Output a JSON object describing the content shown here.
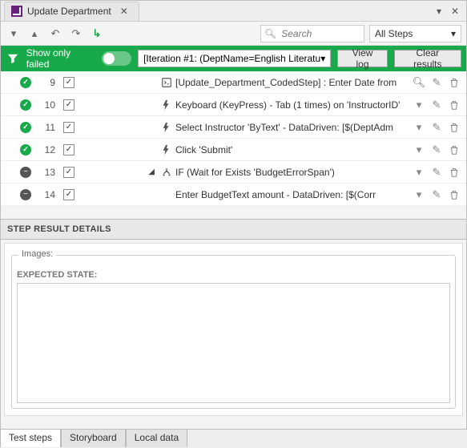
{
  "title": "Update Department",
  "toolbar": {
    "search_placeholder": "Search",
    "filter_label": "All Steps"
  },
  "greenbar": {
    "label": "Show only failed",
    "iteration": "[Iteration #1: (DeptName=English Literatu",
    "viewlog": "View log",
    "clear": "Clear results"
  },
  "steps": [
    {
      "num": "9",
      "status": "pass",
      "icon": "code",
      "desc": "[Update_Department_CodedStep] : Enter Date from",
      "extra": "search"
    },
    {
      "num": "10",
      "status": "pass",
      "icon": "bolt",
      "desc": "Keyboard (KeyPress) - Tab (1 times) on 'InstructorID'",
      "extra": "chev"
    },
    {
      "num": "11",
      "status": "pass",
      "icon": "bolt",
      "desc": "Select Instructor 'ByText'  - DataDriven: [$(DeptAdm",
      "extra": "chev"
    },
    {
      "num": "12",
      "status": "pass",
      "icon": "bolt",
      "desc": "Click 'Submit'",
      "extra": "chev"
    },
    {
      "num": "13",
      "status": "none",
      "icon": "branch",
      "desc": "IF (Wait for Exists 'BudgetErrorSpan')",
      "extra": "chev",
      "expanded": true
    },
    {
      "num": "14",
      "status": "none",
      "icon": "bolt",
      "desc": "Enter BudgetText amount - DataDriven: [$(Corr",
      "extra": "chev",
      "indent": true
    }
  ],
  "details": {
    "header": "STEP RESULT DETAILS",
    "images_label": "Images:",
    "expected_label": "EXPECTED STATE:"
  },
  "tabs": {
    "t1": "Test steps",
    "t2": "Storyboard",
    "t3": "Local data"
  }
}
